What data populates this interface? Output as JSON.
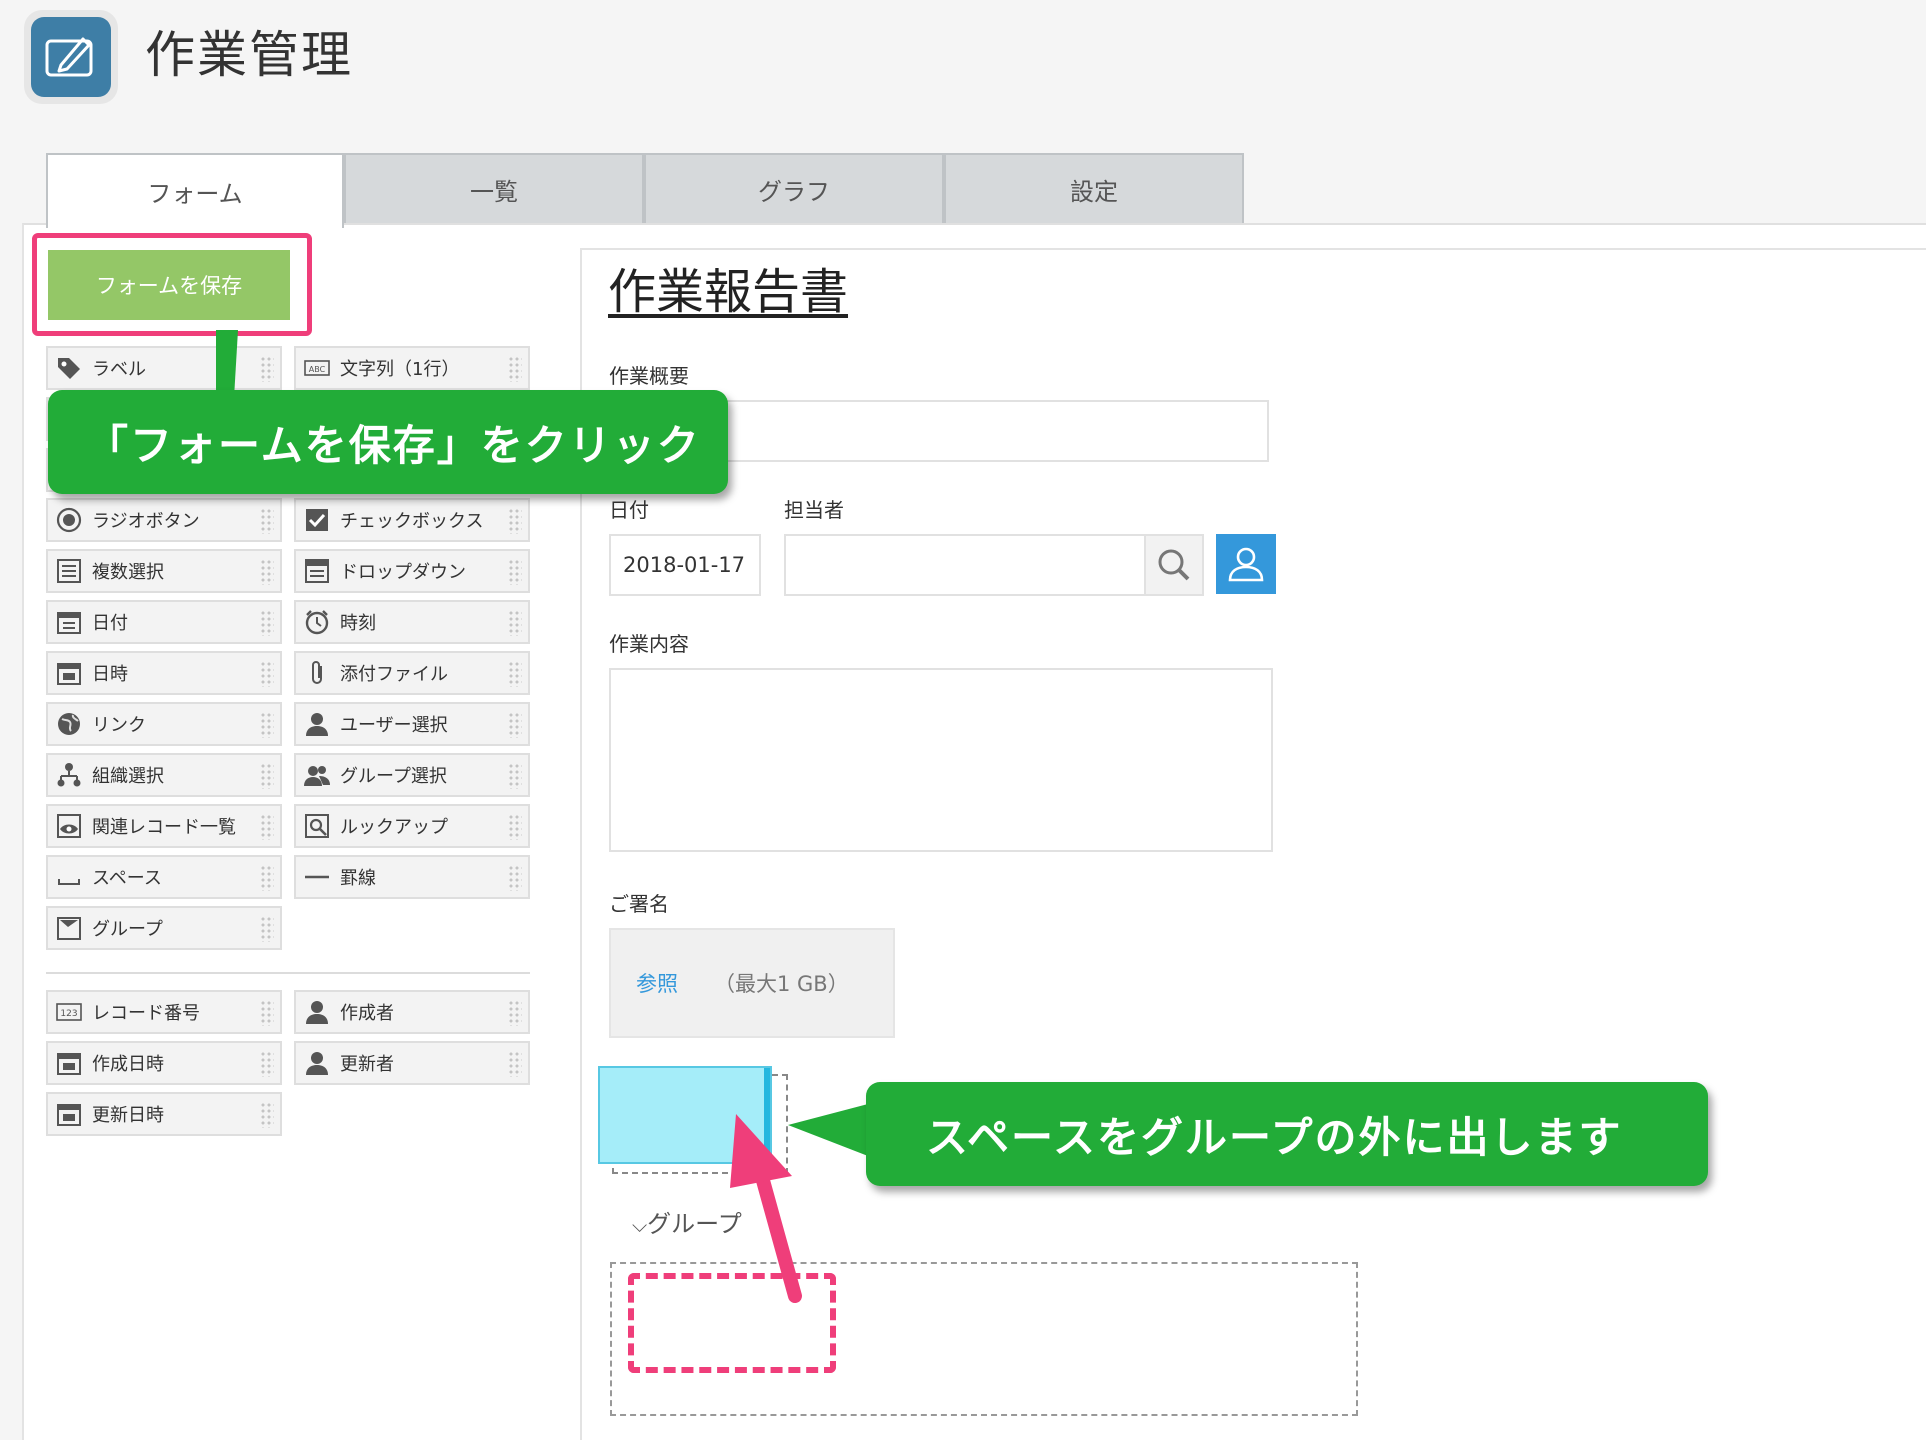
{
  "app": {
    "title": "作業管理"
  },
  "tabs": [
    {
      "label": "フォーム",
      "active": true
    },
    {
      "label": "一覧",
      "active": false
    },
    {
      "label": "グラフ",
      "active": false
    },
    {
      "label": "設定",
      "active": false
    }
  ],
  "toolbar": {
    "save_label": "フォームを保存"
  },
  "palette": {
    "items": [
      {
        "label": "ラベル",
        "icon": "tag-icon"
      },
      {
        "label": "文字列（1行）",
        "icon": "abc-text-icon"
      },
      {
        "label": "ラジオボタン",
        "icon": "radio-icon"
      },
      {
        "label": "チェックボックス",
        "icon": "checkbox-icon"
      },
      {
        "label": "複数選択",
        "icon": "multi-select-icon"
      },
      {
        "label": "ドロップダウン",
        "icon": "dropdown-icon"
      },
      {
        "label": "日付",
        "icon": "calendar-icon"
      },
      {
        "label": "時刻",
        "icon": "alarm-clock-icon"
      },
      {
        "label": "日時",
        "icon": "calendar-time-icon"
      },
      {
        "label": "添付ファイル",
        "icon": "paperclip-icon"
      },
      {
        "label": "リンク",
        "icon": "globe-icon"
      },
      {
        "label": "ユーザー選択",
        "icon": "user-icon"
      },
      {
        "label": "組織選択",
        "icon": "org-chart-icon"
      },
      {
        "label": "グループ選択",
        "icon": "users-icon"
      },
      {
        "label": "関連レコード一覧",
        "icon": "eye-list-icon"
      },
      {
        "label": "ルックアップ",
        "icon": "lookup-icon"
      },
      {
        "label": "スペース",
        "icon": "space-icon"
      },
      {
        "label": "罫線",
        "icon": "line-icon"
      },
      {
        "label": "グループ",
        "icon": "group-icon"
      }
    ],
    "system_items": [
      {
        "label": "レコード番号",
        "icon": "number-123-icon"
      },
      {
        "label": "作成者",
        "icon": "user-icon"
      },
      {
        "label": "作成日時",
        "icon": "calendar-icon"
      },
      {
        "label": "更新者",
        "icon": "user-icon"
      },
      {
        "label": "更新日時",
        "icon": "calendar-icon"
      }
    ]
  },
  "form": {
    "title": "作業報告書",
    "summary_label": "作業概要",
    "date_label": "日付",
    "date_value": "2018-01-17",
    "assignee_label": "担当者",
    "content_label": "作業内容",
    "signature_label": "ご署名",
    "browse_label": "参照",
    "file_limit": "（最大1 GB）",
    "group_label": "グループ"
  },
  "annotations": {
    "save_callout": "「フォームを保存」をクリック",
    "space_callout": "スペースをグループの外に出します"
  },
  "colors": {
    "accent_pink": "#ef3e7a",
    "callout_green": "#22ac38",
    "save_green": "#94c767",
    "user_blue": "#3498db",
    "space_cyan": "#a5edf9"
  }
}
